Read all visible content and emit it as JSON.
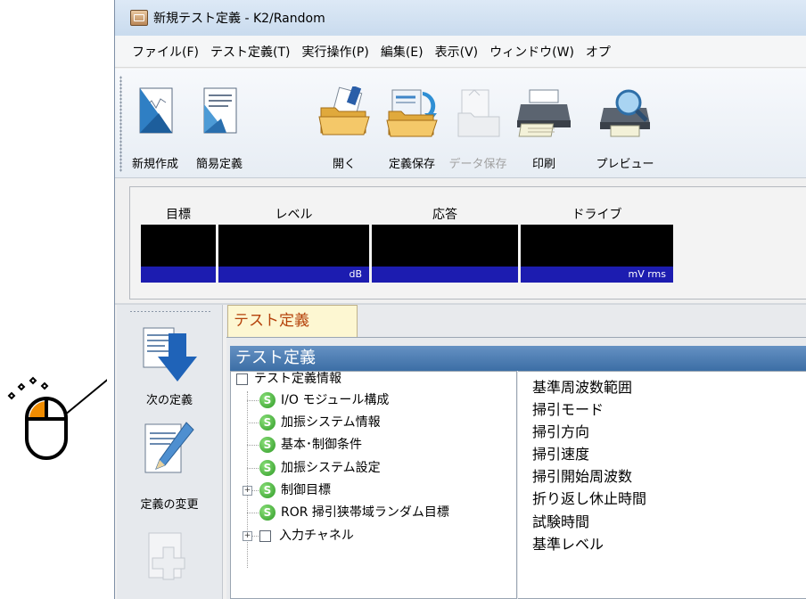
{
  "window": {
    "title": "新規テスト定義 - K2/Random"
  },
  "menu": [
    "ファイル(F)",
    "テスト定義(T)",
    "実行操作(P)",
    "編集(E)",
    "表示(V)",
    "ウィンドウ(W)",
    "オプ"
  ],
  "toolbar": {
    "new": "新規作成",
    "simple": "簡易定義",
    "open": "開く",
    "save_def": "定義保存",
    "save_data": "データ保存",
    "print": "印刷",
    "preview": "プレビュー"
  },
  "meters": [
    {
      "label": "目標",
      "unit": ""
    },
    {
      "label": "レベル",
      "unit": "dB"
    },
    {
      "label": "応答",
      "unit": ""
    },
    {
      "label": "ドライブ",
      "unit": "mV rms"
    }
  ],
  "side": {
    "next": "次の定義",
    "change": "定義の変更"
  },
  "tab": "テスト定義",
  "header": "テスト定義",
  "tree": [
    "テスト定義情報",
    "I/O モジュール構成",
    "加振システム情報",
    "基本･制御条件",
    "加振システム設定",
    "制御目標",
    "ROR 掃引狭帯域ランダム目標",
    "入力チャネル"
  ],
  "s_glyph": "S",
  "params": [
    "基準周波数範囲",
    "掃引モード",
    "掃引方向",
    "掃引速度",
    "掃引開始周波数",
    "折り返し休止時間",
    "試験時間",
    "基準レベル"
  ],
  "colors": {
    "meter_screen": "#000000",
    "meter_unit_bar": "#1c1cb0",
    "header_bar": "#3c6ea5",
    "tab_text": "#b5420b",
    "mouse_accent": "#f08c00"
  }
}
